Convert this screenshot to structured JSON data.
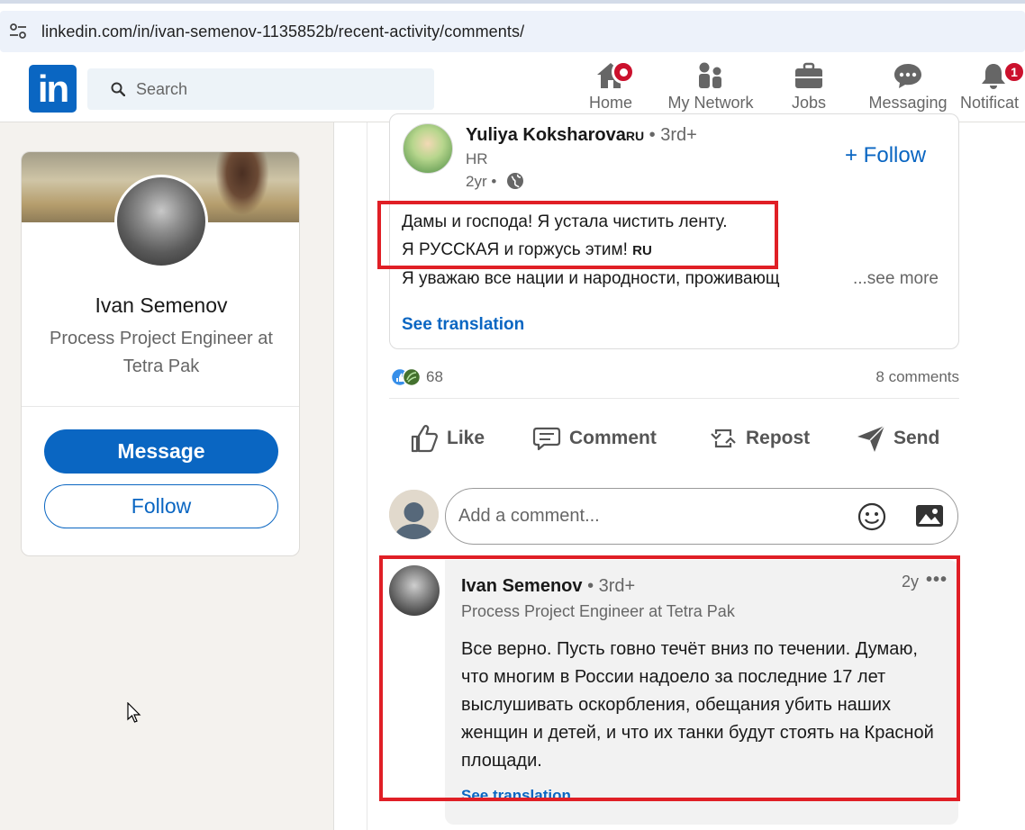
{
  "browser": {
    "url": "linkedin.com/in/ivan-semenov-1135852b/recent-activity/comments/"
  },
  "nav": {
    "logo": "in",
    "search_placeholder": "Search",
    "items": [
      {
        "label": "Home",
        "icon": "home-icon",
        "badge": "•"
      },
      {
        "label": "My Network",
        "icon": "network-icon"
      },
      {
        "label": "Jobs",
        "icon": "briefcase-icon"
      },
      {
        "label": "Messaging",
        "icon": "messaging-icon"
      },
      {
        "label": "Notificat",
        "icon": "bell-icon",
        "badge": "1"
      }
    ]
  },
  "profile": {
    "name": "Ivan Semenov",
    "title": "Process Project Engineer at Tetra Pak",
    "message_label": "Message",
    "follow_label": "Follow"
  },
  "original_post": {
    "author": "Yuliya Koksharova",
    "author_flag": "RU",
    "degree": "• 3rd+",
    "headline": "HR",
    "time": "2yr •",
    "follow_label": "+ Follow",
    "line1": "Дамы и господа! Я устала чистить ленту.",
    "line2": "Я РУССКАЯ и горжусь этим! ",
    "line2_flag": "RU",
    "line3": "Я уважаю все нации и народности, проживающ",
    "see_more": "...see more",
    "see_translation": "See translation"
  },
  "stats": {
    "reactions": "68",
    "comments": "8 comments"
  },
  "actions": {
    "like": "Like",
    "comment": "Comment",
    "repost": "Repost",
    "send": "Send"
  },
  "add_comment": {
    "placeholder": "Add a comment..."
  },
  "comment": {
    "author": "Ivan Semenov",
    "degree": "• 3rd+",
    "headline": "Process Project Engineer at Tetra Pak",
    "time": "2y",
    "more": "•••",
    "text": "Все верно. Пусть говно течёт вниз по течении. Думаю, что многим в России надоело за последние 17 лет выслушивать оскорбления, обещания убить наших женщин и детей, и что их танки будут стоять на Красной площади.",
    "see_translation": "See translation"
  },
  "colors": {
    "brand": "#0a66c2",
    "highlight": "#e01f26",
    "badge": "#cb112d"
  }
}
